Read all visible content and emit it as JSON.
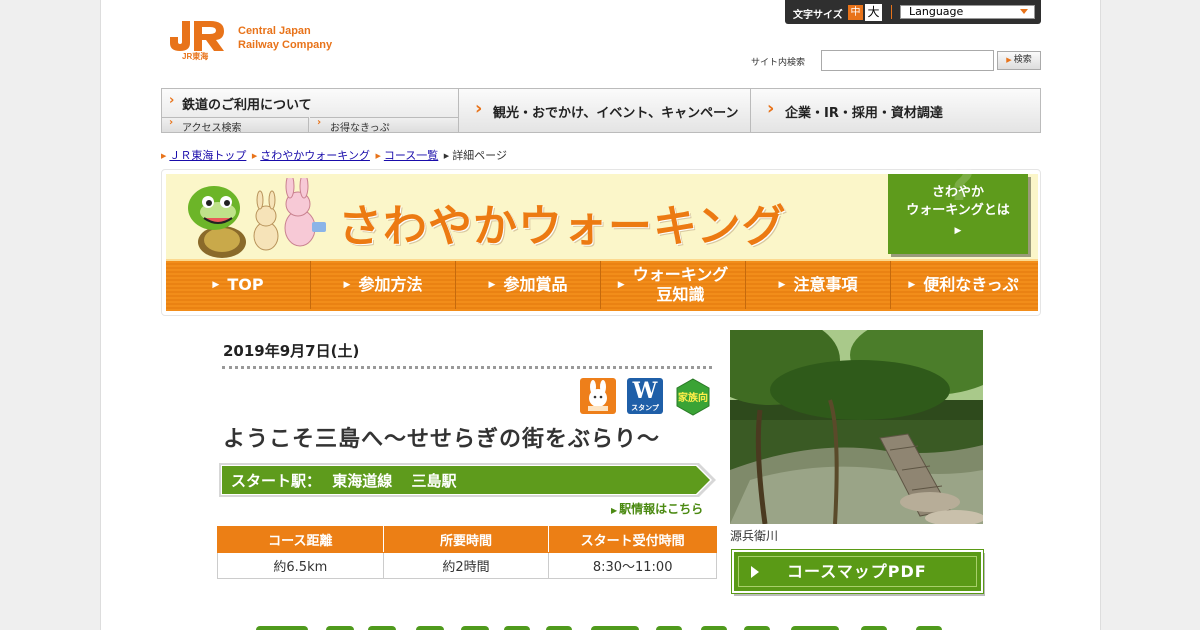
{
  "header": {
    "logo_text_line1": "Central Japan",
    "logo_text_line2": "Railway Company",
    "logo_sub": "JR東海",
    "font_size_label": "文字サイズ",
    "font_size_mid": "中",
    "font_size_large": "大",
    "language_label": "Language",
    "search_label": "サイト内検索",
    "search_value": "",
    "search_button": "検索"
  },
  "nav": {
    "rail_main": "鉄道のご利用について",
    "rail_sub_access": "アクセス検索",
    "rail_sub_tickets": "お得なきっぷ",
    "sightseeing": "観光・おでかけ、イベント、キャンペーン",
    "corporate": "企業・IR・採用・資材調達"
  },
  "breadcrumb": {
    "items": [
      "ＪＲ東海トップ",
      "さわやかウォーキング",
      "コース一覧"
    ],
    "current": "詳細ページ"
  },
  "banner": {
    "title": "さわやかウォーキング",
    "about_line1": "さわやか",
    "about_line2": "ウォーキングとは",
    "menu": [
      "TOP",
      "参加方法",
      "参加賞品",
      "ウォーキング",
      "豆知識",
      "注意事項",
      "便利なきっぷ"
    ]
  },
  "event": {
    "date": "2019年9月7日(土)",
    "badge_w": "W",
    "badge_w_sub": "スタンプ",
    "badge_family": "家族向",
    "title": "ようこそ三島へ～せせらぎの街をぶらり～",
    "start_label": "スタート駅：",
    "start_line": "東海道線",
    "start_station": "三島駅",
    "station_link": "駅情報はこちら",
    "table_headers": [
      "コース距離",
      "所要時間",
      "スタート受付時間"
    ],
    "table_values": [
      "約6.5km",
      "約2時間",
      "8:30～11:00"
    ],
    "photo_caption": "源兵衛川",
    "pdf_button": "コースマップPDF"
  },
  "colors": {
    "brand_orange": "#ec7f15",
    "walking_green": "#5a9a16",
    "banner_cream": "#fbf6c9"
  }
}
